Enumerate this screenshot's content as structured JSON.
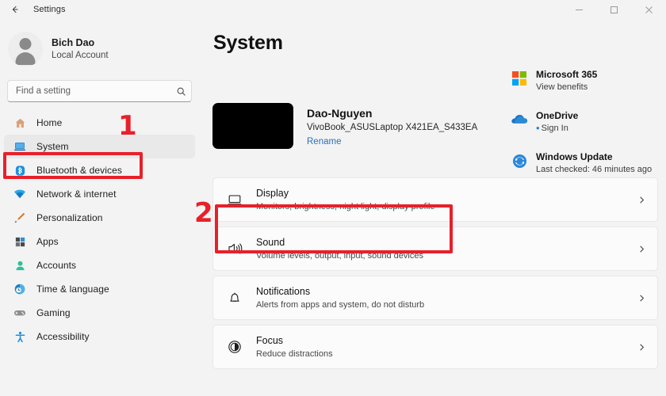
{
  "titlebar": {
    "back_icon": "arrow-left-icon",
    "title": "Settings",
    "minimize_label": "–",
    "maximize_label": "❑",
    "close_label": "✕"
  },
  "sidebar": {
    "profile": {
      "name": "Bich Dao",
      "account_type": "Local Account",
      "avatar_icon": "user-avatar-icon"
    },
    "search": {
      "placeholder": "Find a setting",
      "value": "",
      "icon": "search-icon"
    },
    "items": [
      {
        "label": "Home",
        "icon": "home-icon",
        "selected": false
      },
      {
        "label": "System",
        "icon": "system-icon",
        "selected": true
      },
      {
        "label": "Bluetooth & devices",
        "icon": "bluetooth-icon",
        "selected": false
      },
      {
        "label": "Network & internet",
        "icon": "wifi-icon",
        "selected": false
      },
      {
        "label": "Personalization",
        "icon": "brush-icon",
        "selected": false
      },
      {
        "label": "Apps",
        "icon": "apps-icon",
        "selected": false
      },
      {
        "label": "Accounts",
        "icon": "accounts-icon",
        "selected": false
      },
      {
        "label": "Time & language",
        "icon": "clock-icon",
        "selected": false
      },
      {
        "label": "Gaming",
        "icon": "gamepad-icon",
        "selected": false
      },
      {
        "label": "Accessibility",
        "icon": "accessibility-icon",
        "selected": false
      }
    ]
  },
  "main": {
    "page_title": "System",
    "device": {
      "name": "Dao-Nguyen",
      "model": "VivoBook_ASUSLaptop X421EA_S433EA",
      "rename_label": "Rename"
    },
    "info_cards": [
      {
        "title": "Microsoft 365",
        "subtitle": "View benefits",
        "icon": "microsoft-365-icon",
        "bullet": false
      },
      {
        "title": "OneDrive",
        "subtitle": "Sign In",
        "icon": "onedrive-icon",
        "bullet": true
      },
      {
        "title": "Windows Update",
        "subtitle": "Last checked: 46 minutes ago",
        "icon": "windows-update-icon",
        "bullet": false
      }
    ],
    "settings": [
      {
        "title": "Display",
        "subtitle": "Monitors, brightness, night light, display profile",
        "icon": "display-icon",
        "chevron": "chevron-right-icon"
      },
      {
        "title": "Sound",
        "subtitle": "Volume levels, output, input, sound devices",
        "icon": "sound-icon",
        "chevron": "chevron-right-icon"
      },
      {
        "title": "Notifications",
        "subtitle": "Alerts from apps and system, do not disturb",
        "icon": "notifications-icon",
        "chevron": "chevron-right-icon"
      },
      {
        "title": "Focus",
        "subtitle": "Reduce distractions",
        "icon": "focus-icon",
        "chevron": "chevron-right-icon"
      }
    ]
  },
  "annotations": {
    "markers": [
      {
        "label": "1",
        "target": "sidebar-item-system"
      },
      {
        "label": "2",
        "target": "settings-row-display"
      }
    ],
    "highlight_color": "#e8202a"
  }
}
